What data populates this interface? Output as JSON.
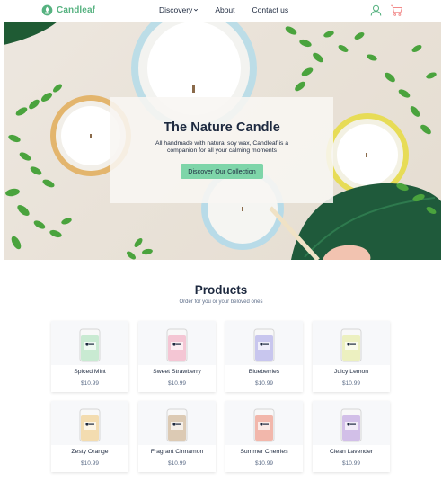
{
  "brand": {
    "name": "Candleaf",
    "accent": "#56b280"
  },
  "nav": {
    "items": [
      {
        "label": "Discovery",
        "has_dropdown": true
      },
      {
        "label": "About"
      },
      {
        "label": "Contact us"
      }
    ],
    "icons": [
      "user-icon",
      "cart-icon"
    ]
  },
  "hero": {
    "title": "The Nature Candle",
    "subtitle": "All handmade with natural soy wax, Candleaf is a companion for all your calming moments",
    "button_label": "Discover Our Collection",
    "button_color": "#7ed5a9"
  },
  "products": {
    "title": "Products",
    "subtitle": "Order for you or your beloved ones",
    "items": [
      {
        "name": "Spiced Mint",
        "price": "$10.99",
        "color": "#c9ead2"
      },
      {
        "name": "Sweet Strawberry",
        "price": "$10.99",
        "color": "#f4c6d4"
      },
      {
        "name": "Blueberries",
        "price": "$10.99",
        "color": "#c8c6ee"
      },
      {
        "name": "Juicy Lemon",
        "price": "$10.99",
        "color": "#ecf0c0"
      },
      {
        "name": "Zesty Orange",
        "price": "$10.99",
        "color": "#f3dcb0"
      },
      {
        "name": "Fragrant Cinnamon",
        "price": "$10.99",
        "color": "#dccab4"
      },
      {
        "name": "Summer Cherries",
        "price": "$10.99",
        "color": "#f2b7ab"
      },
      {
        "name": "Clean Lavender",
        "price": "$10.99",
        "color": "#d2bfe8"
      }
    ]
  }
}
